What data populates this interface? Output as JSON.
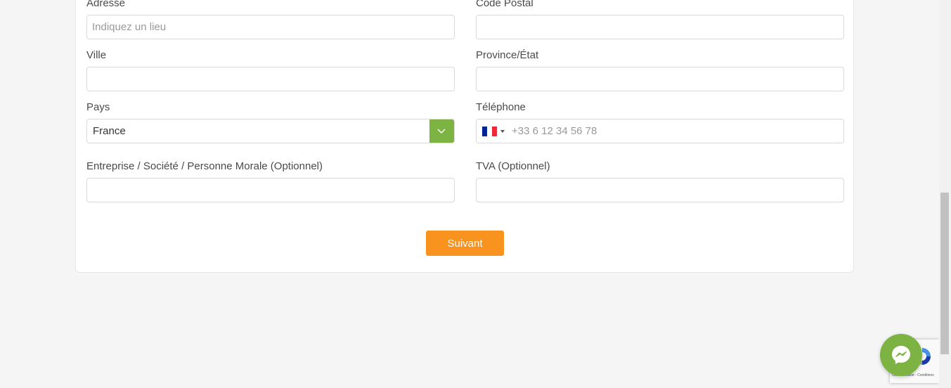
{
  "form": {
    "address": {
      "label": "Adresse",
      "placeholder": "Indiquez un lieu",
      "value": ""
    },
    "postal_code": {
      "label": "Code Postal",
      "value": ""
    },
    "city": {
      "label": "Ville",
      "value": ""
    },
    "province": {
      "label": "Province/État",
      "value": ""
    },
    "country": {
      "label": "Pays",
      "value": "France",
      "dropdown_icon": "chevron-down-icon"
    },
    "phone": {
      "label": "Téléphone",
      "placeholder": "+33 6 12 34 56 78",
      "value": "",
      "flag": "france-flag-icon"
    },
    "company": {
      "label": "Entreprise / Société / Personne Morale (Optionnel)",
      "value": ""
    },
    "vat": {
      "label": "TVA (Optionnel)",
      "value": ""
    },
    "next_button": {
      "label": "Suivant"
    }
  },
  "recaptcha": {
    "text": "Confidentialité - Conditions"
  },
  "colors": {
    "accent_orange": "#f7931e",
    "accent_green": "#7cb342",
    "background": "#f5f5f5"
  },
  "widgets": {
    "chat_icon": "messenger-icon",
    "recaptcha_icon": "recaptcha-icon"
  }
}
